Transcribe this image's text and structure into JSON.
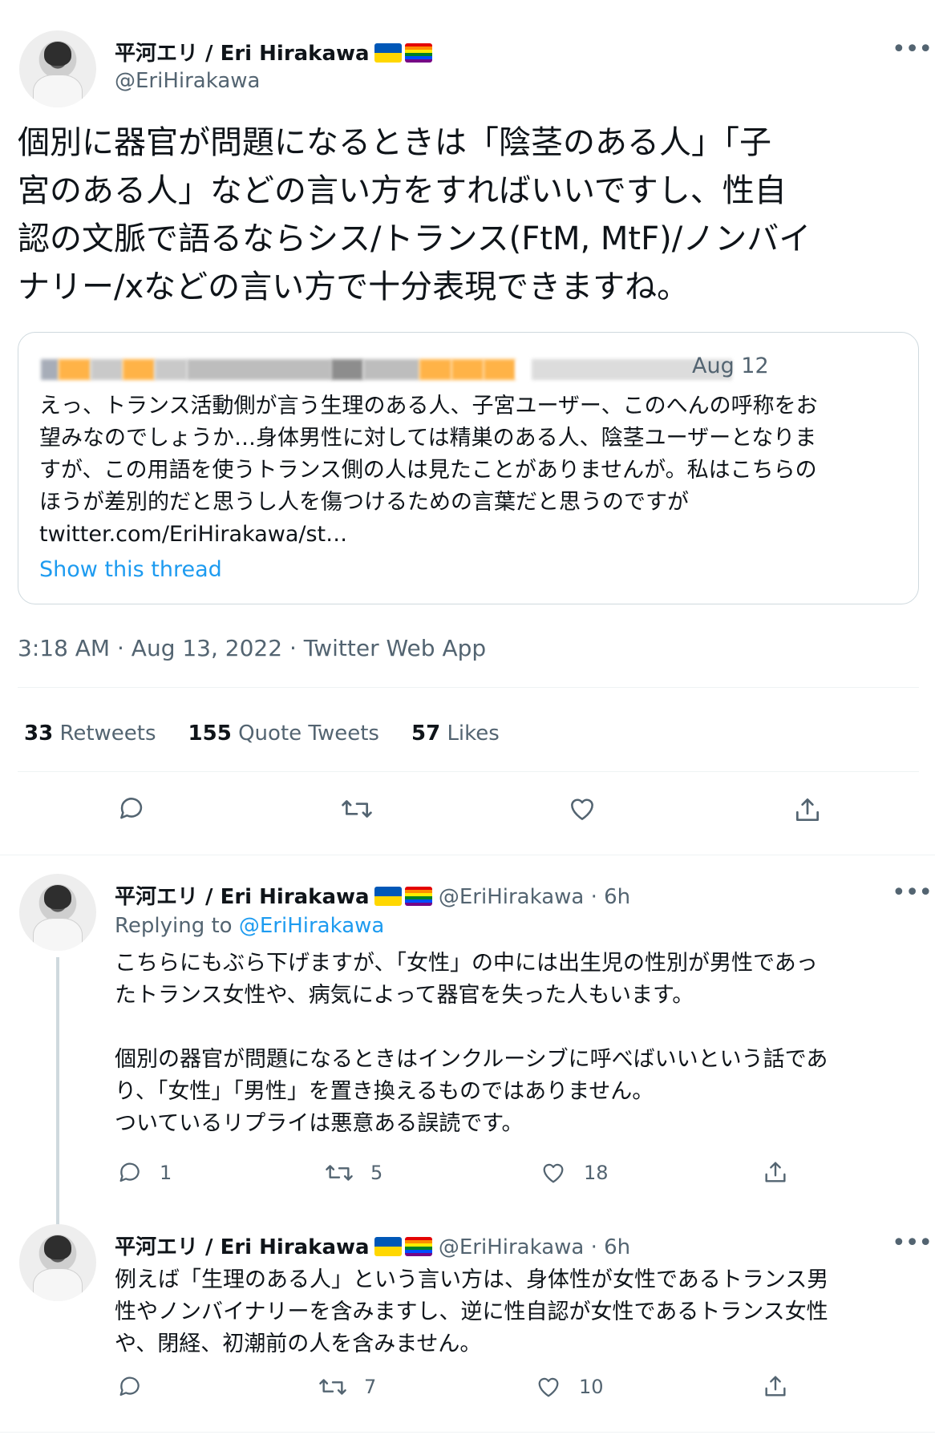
{
  "main": {
    "name": "平河エリ / Eri Hirakawa",
    "handle": "@EriHirakawa",
    "text": "個別に器官が問題になるときは「陰茎のある人」「子\n宮のある人」などの言い方をすればいいですし、性自\n認の文脈で語るならシス/トランス(FtM, MtF)/ノンバイ\nナリー/xなどの言い方で十分表現できますね。",
    "quote": {
      "date": "Aug 12",
      "text": "えっ、トランス活動側が言う生理のある人、子宮ユーザー、このへんの呼称をお\n望みなのでしょうか…身体男性に対しては精巣のある人、陰茎ユーザーとなりま\nすが、この用語を使うトランス側の人は見たことがありませんが。私はこちらの\nほうが差別的だと思うし人を傷つけるための言葉だと思うのですが",
      "link": "twitter.com/EriHirakawa/st…",
      "show_thread": "Show this thread"
    },
    "meta": "3:18 AM · Aug 13, 2022 · Twitter Web App",
    "stats": {
      "retweets_count": "33",
      "retweets_label": "Retweets",
      "quotes_count": "155",
      "quotes_label": "Quote Tweets",
      "likes_count": "57",
      "likes_label": "Likes"
    }
  },
  "replies": [
    {
      "name": "平河エリ / Eri Hirakawa",
      "handle_time": "@EriHirakawa · 6h",
      "replying_prefix": "Replying to",
      "replying_handle": "@EriHirakawa",
      "text": "こちらにもぶら下げますが、「女性」の中には出生児の性別が男性であっ\nたトランス女性や、病気によって器官を失った人もいます。\n\n個別の器官が問題になるときはインクルーシブに呼べばいいという話であ\nり、「女性」「男性」を置き換えるものではありません。\nついているリプライは悪意ある誤読です。",
      "reply_count": "1",
      "retweet_count": "5",
      "like_count": "18"
    },
    {
      "name": "平河エリ / Eri Hirakawa",
      "handle_time": "@EriHirakawa · 6h",
      "text": "例えば「生理のある人」という言い方は、身体性が女性であるトランス男\n性やノンバイナリーを含みますし、逆に性自認が女性であるトランス女性\nや、閉経、初潮前の人を含みません。",
      "reply_count": "",
      "retweet_count": "7",
      "like_count": "10"
    }
  ],
  "more_icon": "•••",
  "colors": {
    "accent": "#1d9bf0",
    "muted": "#536471",
    "text": "#0f1419",
    "border": "#cfd9de"
  }
}
